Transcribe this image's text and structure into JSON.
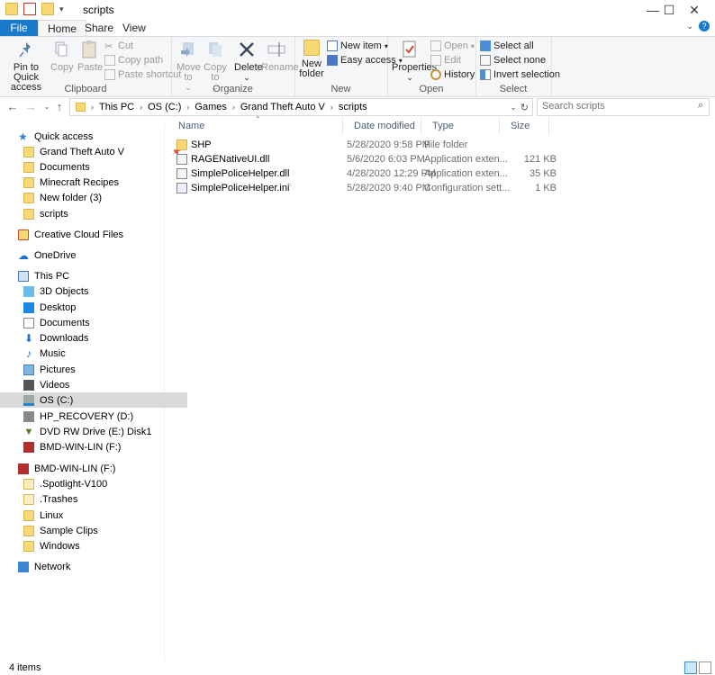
{
  "window": {
    "title": "scripts"
  },
  "titlebar": {
    "minimize": "—",
    "maximize": "☐",
    "close": "✕"
  },
  "ribbon_tabs": {
    "file": "File",
    "home": "Home",
    "share": "Share",
    "view": "View"
  },
  "ribbon": {
    "clipboard": {
      "label": "Clipboard",
      "pin": "Pin to Quick access",
      "copy": "Copy",
      "paste": "Paste",
      "cut": "Cut",
      "copy_path": "Copy path",
      "paste_shortcut": "Paste shortcut"
    },
    "organize": {
      "label": "Organize",
      "move_to": "Move to",
      "copy_to": "Copy to",
      "delete": "Delete",
      "rename": "Rename"
    },
    "new": {
      "label": "New",
      "new_folder": "New folder",
      "new_item": "New item",
      "easy_access": "Easy access"
    },
    "open": {
      "label": "Open",
      "properties": "Properties",
      "open": "Open",
      "edit": "Edit",
      "history": "History"
    },
    "select": {
      "label": "Select",
      "select_all": "Select all",
      "select_none": "Select none",
      "invert_selection": "Invert selection"
    }
  },
  "address": {
    "crumbs": [
      "This PC",
      "OS (C:)",
      "Games",
      "Grand Theft Auto V",
      "scripts"
    ],
    "search_placeholder": "Search scripts"
  },
  "navpane": {
    "quick_access": "Quick access",
    "quick_items": [
      "Grand Theft Auto V",
      "Documents",
      "Minecraft Recipes",
      "New folder (3)",
      "scripts"
    ],
    "creative_cloud": "Creative Cloud Files",
    "onedrive": "OneDrive",
    "this_pc": "This PC",
    "pc_items": [
      "3D Objects",
      "Desktop",
      "Documents",
      "Downloads",
      "Music",
      "Pictures",
      "Videos",
      "OS (C:)",
      "HP_RECOVERY (D:)",
      "DVD RW Drive (E:) Disk1",
      "BMD-WIN-LIN (F:)"
    ],
    "bmd": "BMD-WIN-LIN (F:)",
    "bmd_items": [
      ".Spotlight-V100",
      ".Trashes",
      "Linux",
      "Sample Clips",
      "Windows"
    ],
    "network": "Network"
  },
  "columns": {
    "name": "Name",
    "date": "Date modified",
    "type": "Type",
    "size": "Size"
  },
  "files": [
    {
      "name": "SHP",
      "date": "5/28/2020 9:58 PM",
      "type": "File folder",
      "size": ""
    },
    {
      "name": "RAGENativeUI.dll",
      "date": "5/6/2020 6:03 PM",
      "type": "Application exten...",
      "size": "121 KB"
    },
    {
      "name": "SimplePoliceHelper.dll",
      "date": "4/28/2020 12:29 PM",
      "type": "Application exten...",
      "size": "35 KB"
    },
    {
      "name": "SimplePoliceHelper.ini",
      "date": "5/28/2020 9:40 PM",
      "type": "Configuration sett...",
      "size": "1 KB"
    }
  ],
  "status": {
    "count": "4 items"
  }
}
